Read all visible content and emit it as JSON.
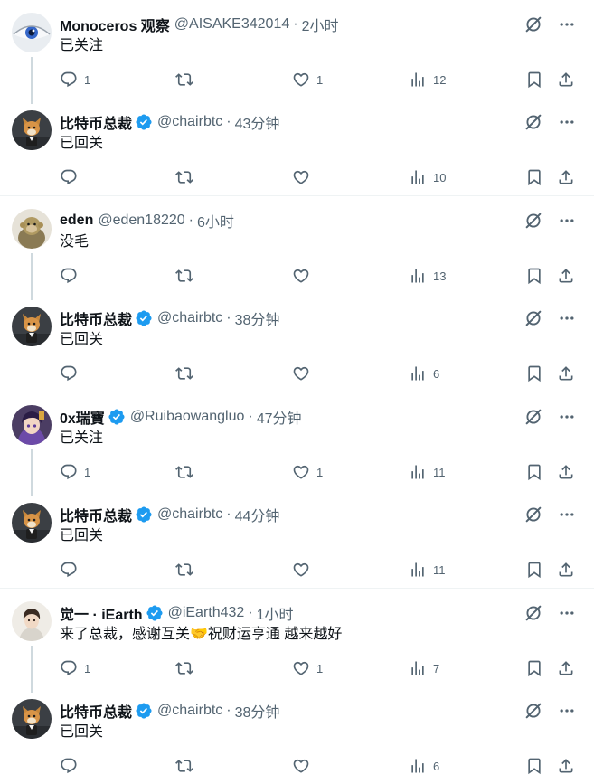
{
  "colors": {
    "verified": "#1d9bf0",
    "muted": "#536471",
    "thread_line": "#cfd9de"
  },
  "icons": [
    "reply-icon",
    "retweet-icon",
    "like-icon",
    "views-icon",
    "bookmark-icon",
    "share-icon",
    "grok-icon",
    "more-icon",
    "verified-badge-icon"
  ],
  "separator": "·",
  "tweets": [
    {
      "name": "Monoceros 观察",
      "handle": "@AISAKE342014",
      "time": "2小时",
      "verified": false,
      "text": "已关注",
      "reply_count": "1",
      "retweet_count": "",
      "like_count": "1",
      "views": "12",
      "thread": true,
      "avatar": "eye"
    },
    {
      "name": "比特币总裁",
      "handle": "@chairbtc",
      "time": "43分钟",
      "verified": true,
      "text": "已回关",
      "reply_count": "",
      "retweet_count": "",
      "like_count": "",
      "views": "10",
      "thread": false,
      "avatar": "dog"
    },
    {
      "name": "eden",
      "handle": "@eden18220",
      "time": "6小时",
      "verified": false,
      "text": "没毛",
      "reply_count": "",
      "retweet_count": "",
      "like_count": "",
      "views": "13",
      "thread": true,
      "avatar": "monkey"
    },
    {
      "name": "比特币总裁",
      "handle": "@chairbtc",
      "time": "38分钟",
      "verified": true,
      "text": "已回关",
      "reply_count": "",
      "retweet_count": "",
      "like_count": "",
      "views": "6",
      "thread": false,
      "avatar": "dog"
    },
    {
      "name": "0x瑞寶",
      "handle": "@Ruibaowangluo",
      "time": "47分钟",
      "verified": true,
      "text": "已关注",
      "reply_count": "1",
      "retweet_count": "",
      "like_count": "1",
      "views": "11",
      "thread": true,
      "avatar": "anime"
    },
    {
      "name": "比特币总裁",
      "handle": "@chairbtc",
      "time": "44分钟",
      "verified": true,
      "text": "已回关",
      "reply_count": "",
      "retweet_count": "",
      "like_count": "",
      "views": "11",
      "thread": false,
      "avatar": "dog"
    },
    {
      "name": "觉一 · iEarth",
      "handle": "@iEarth432",
      "time": "1小时",
      "verified": true,
      "text": "来了总裁，感谢互关🤝祝财运亨通 越来越好",
      "reply_count": "1",
      "retweet_count": "",
      "like_count": "1",
      "views": "7",
      "thread": true,
      "avatar": "person"
    },
    {
      "name": "比特币总裁",
      "handle": "@chairbtc",
      "time": "38分钟",
      "verified": true,
      "text": "已回关",
      "reply_count": "",
      "retweet_count": "",
      "like_count": "",
      "views": "6",
      "thread": false,
      "avatar": "dog"
    }
  ]
}
